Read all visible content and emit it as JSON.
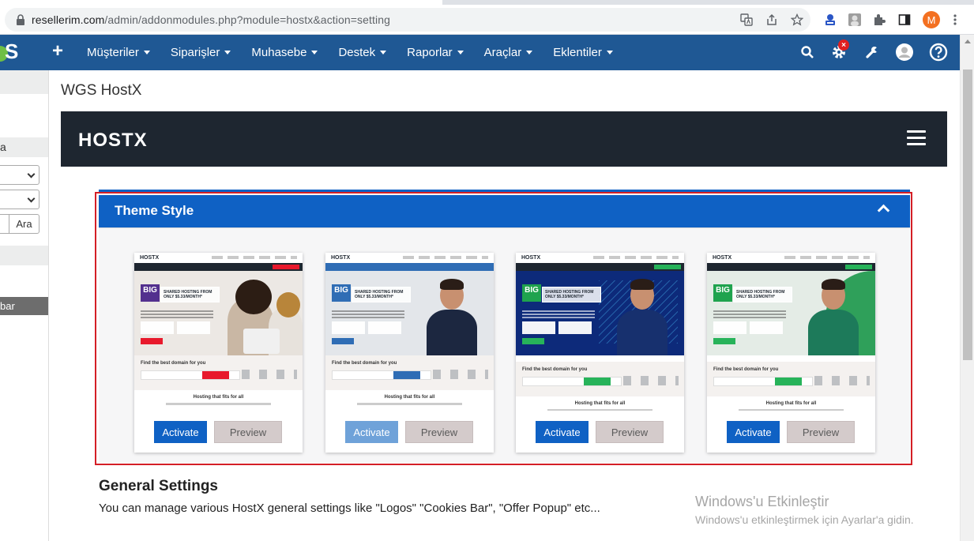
{
  "browser": {
    "url_host": "resellerim.com",
    "url_path": "/admin/addonmodules.php?module=hostx&action=setting",
    "profile_initial": "M",
    "icons": [
      "lock-icon",
      "translate-icon",
      "share-icon",
      "star-icon",
      "extension-badge-icon",
      "profile-photo-icon",
      "puzzle-icon",
      "sidebar-icon",
      "kebab-menu-icon"
    ]
  },
  "navbar": {
    "menu": [
      "Müşteriler",
      "Siparişler",
      "Muhasebe",
      "Destek",
      "Raporlar",
      "Araçlar",
      "Eklentiler"
    ],
    "notification_badge": "×",
    "colors": {
      "bg": "#1f5894",
      "accent": "#6fbf45"
    }
  },
  "sidebar": {
    "label_a": "a",
    "search_button": "Ara",
    "label_bar": "bar"
  },
  "page": {
    "title": "WGS HostX",
    "brand": "HOSTX"
  },
  "theme_panel": {
    "title": "Theme Style",
    "themes": [
      {
        "activate": "Activate",
        "preview": "Preview",
        "active": false,
        "preview_text": {
          "big": "BIG",
          "headline": "SHARED HOSTING FROM ONLY $5.33/MONTH*",
          "domain": "Find the best domain for you",
          "fits": "Hosting that fits for all"
        },
        "colors": {
          "nav": "#1e2630",
          "button": "#e8192c",
          "hero": "#ece8e4"
        }
      },
      {
        "activate": "Activate",
        "preview": "Preview",
        "active": true,
        "preview_text": {
          "big": "BIG",
          "headline": "SHARED HOSTING FROM ONLY $5.33/MONTH*",
          "domain": "Find the best domain for you",
          "fits": "Hosting that fits for all"
        },
        "colors": {
          "nav": "#2f6db5",
          "button": "#2f6db5",
          "hero": "#e3e6ea"
        }
      },
      {
        "activate": "Activate",
        "preview": "Preview",
        "active": false,
        "preview_text": {
          "big": "BIG",
          "headline": "SHARED HOSTING FROM ONLY $5.33/MONTH*",
          "domain": "Find the best domain for you",
          "fits": "Hosting that fits for all"
        },
        "colors": {
          "nav": "#1e2630",
          "button": "#27b35a",
          "hero": "#0d2a7a"
        }
      },
      {
        "activate": "Activate",
        "preview": "Preview",
        "active": false,
        "preview_text": {
          "big": "BIG",
          "headline": "SHARED HOSTING FROM ONLY $5.33/MONTH*",
          "domain": "Find the best domain for you",
          "fits": "Hosting that fits for all"
        },
        "colors": {
          "nav": "#1e2630",
          "button": "#27b35a",
          "hero": "#e4ece6"
        }
      }
    ]
  },
  "general_settings": {
    "title": "General Settings",
    "description": "You can manage various HostX general settings like \"Logos\" \"Cookies Bar\", \"Offer Popup\" etc..."
  },
  "watermark": {
    "line1": "Windows'u Etkinleştir",
    "line2": "Windows'u etkinleştirmek için Ayarlar'a gidin."
  }
}
